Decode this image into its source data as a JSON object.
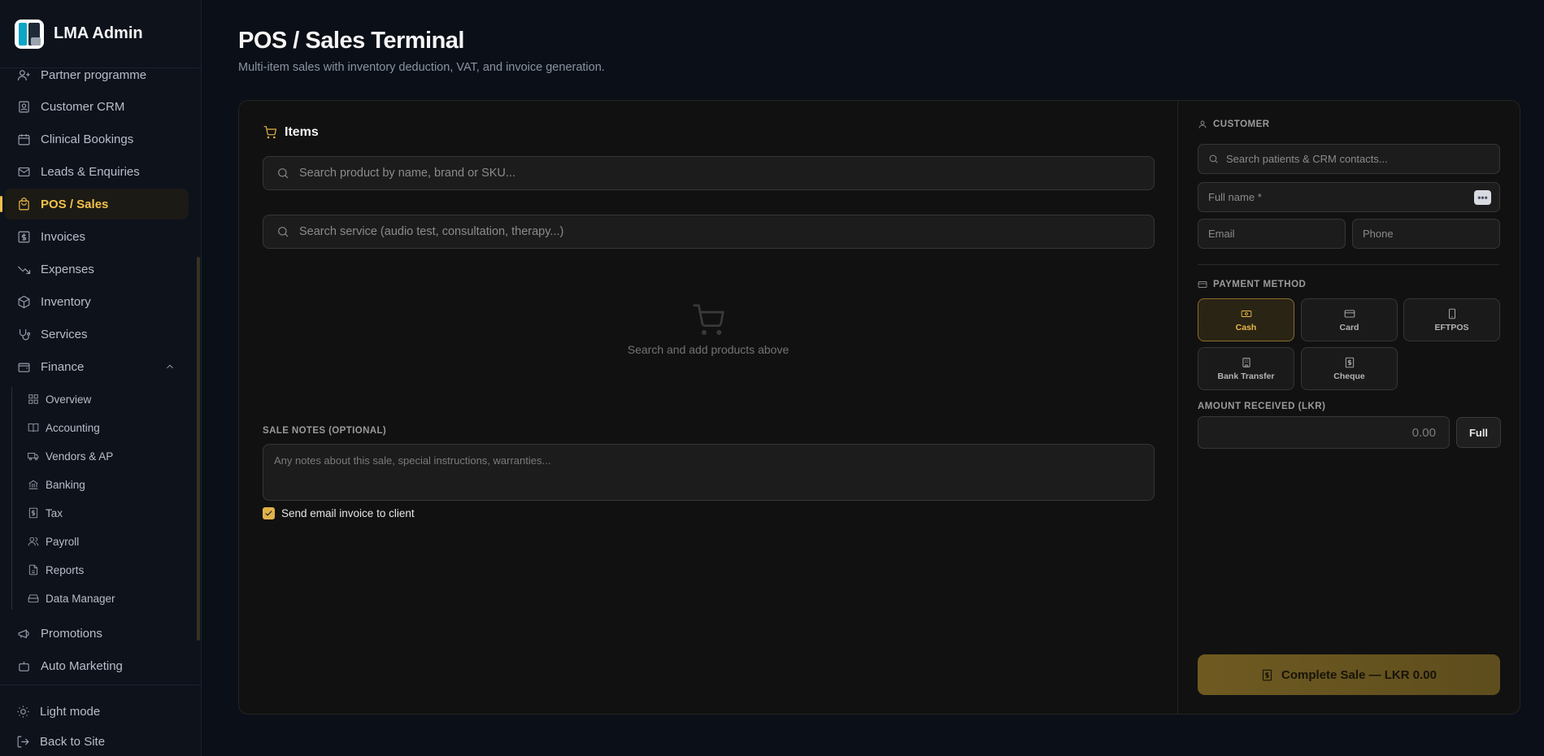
{
  "brand": {
    "name": "LMA Admin"
  },
  "sidebar": {
    "items": [
      {
        "label": "Partner programme",
        "icon": "user-plus-icon"
      },
      {
        "label": "Customer CRM",
        "icon": "contact-card-icon"
      },
      {
        "label": "Clinical Bookings",
        "icon": "calendar-icon"
      },
      {
        "label": "Leads & Enquiries",
        "icon": "mail-icon"
      },
      {
        "label": "POS / Sales",
        "icon": "shopping-bag-icon",
        "active": true
      },
      {
        "label": "Invoices",
        "icon": "dollar-square-icon"
      },
      {
        "label": "Expenses",
        "icon": "trending-down-icon"
      },
      {
        "label": "Inventory",
        "icon": "box-icon"
      },
      {
        "label": "Services",
        "icon": "stethoscope-icon"
      },
      {
        "label": "Finance",
        "icon": "wallet-icon",
        "expanded": true
      }
    ],
    "finance_sub": [
      {
        "label": "Overview",
        "icon": "grid-icon"
      },
      {
        "label": "Accounting",
        "icon": "book-icon"
      },
      {
        "label": "Vendors & AP",
        "icon": "truck-icon"
      },
      {
        "label": "Banking",
        "icon": "bank-icon"
      },
      {
        "label": "Tax",
        "icon": "receipt-icon"
      },
      {
        "label": "Payroll",
        "icon": "users-icon"
      },
      {
        "label": "Reports",
        "icon": "file-icon"
      },
      {
        "label": "Data Manager",
        "icon": "hard-drive-icon"
      }
    ],
    "after": [
      {
        "label": "Promotions",
        "icon": "megaphone-icon"
      },
      {
        "label": "Auto Marketing",
        "icon": "bot-icon"
      }
    ],
    "bottom": {
      "light_mode": "Light mode",
      "back_to_site": "Back to Site"
    }
  },
  "header": {
    "title": "POS / Sales Terminal",
    "subtitle": "Multi-item sales with inventory deduction, VAT, and invoice generation."
  },
  "items_panel": {
    "title": "Items",
    "product_search_placeholder": "Search product by name, brand or SKU...",
    "service_search_placeholder": "Search service (audio test, consultation, therapy...)",
    "empty_text": "Search and add products above",
    "notes_label": "SALE NOTES (OPTIONAL)",
    "notes_placeholder": "Any notes about this sale, special instructions, warranties...",
    "send_email_label": "Send email invoice to client",
    "send_email_checked": true
  },
  "customer": {
    "label": "CUSTOMER",
    "search_placeholder": "Search patients & CRM contacts...",
    "full_name_placeholder": "Full name *",
    "email_placeholder": "Email",
    "phone_placeholder": "Phone"
  },
  "payment": {
    "label": "PAYMENT METHOD",
    "methods": [
      {
        "label": "Cash",
        "icon": "banknote-icon",
        "selected": true
      },
      {
        "label": "Card",
        "icon": "credit-card-icon"
      },
      {
        "label": "EFTPOS",
        "icon": "smartphone-icon"
      },
      {
        "label": "Bank Transfer",
        "icon": "bank-icon"
      },
      {
        "label": "Cheque",
        "icon": "receipt-icon"
      }
    ],
    "amount_label": "AMOUNT RECEIVED (LKR)",
    "amount_value": "0.00",
    "full_label": "Full"
  },
  "complete_button": {
    "label": "Complete Sale — LKR 0.00"
  },
  "colors": {
    "accent": "#f2c14b",
    "background": "#0b0f17",
    "panel": "#111111"
  }
}
